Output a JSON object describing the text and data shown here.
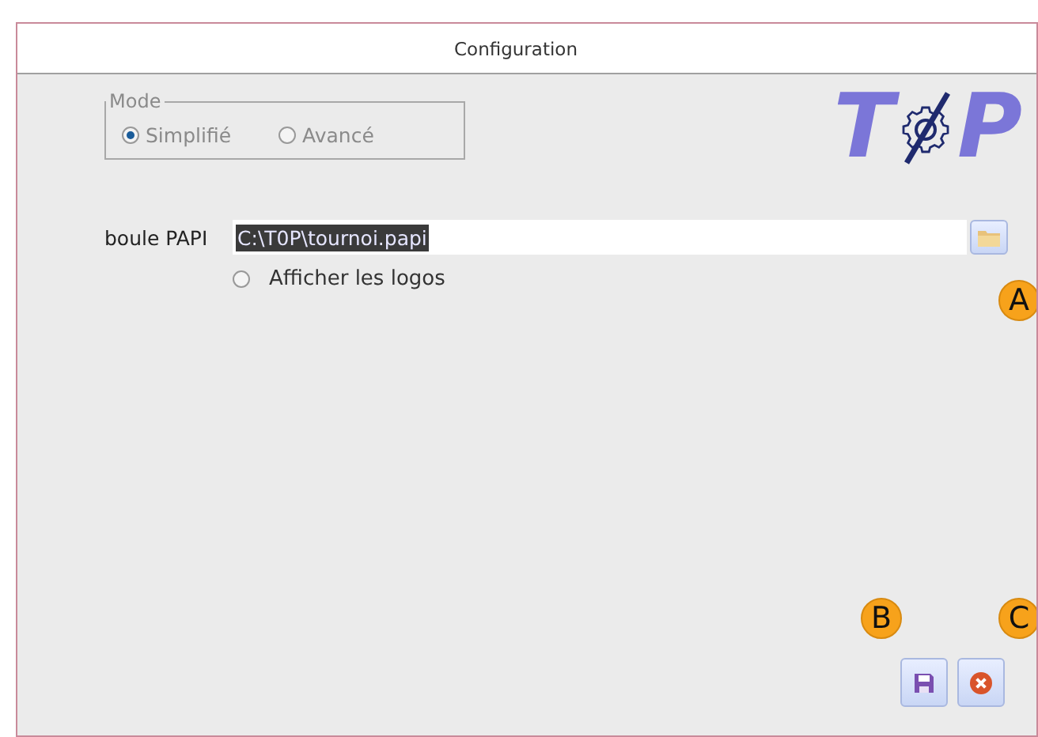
{
  "window": {
    "title": "Configuration"
  },
  "mode": {
    "legend": "Mode",
    "options": [
      {
        "label": "Simplifié",
        "selected": true,
        "disabled": true
      },
      {
        "label": "Avancé",
        "selected": false,
        "disabled": true
      }
    ]
  },
  "logo": {
    "letters": [
      "T",
      "P"
    ]
  },
  "papi_file": {
    "label": "boule PAPI",
    "value": "C:\\T0P\\tournoi.papi",
    "value_selected": true,
    "browse_callout": "A"
  },
  "show_logos": {
    "label": "Afficher les logos",
    "checked": false
  },
  "buttons": [
    {
      "kind": "save",
      "callout": "B"
    },
    {
      "kind": "cancel",
      "callout": "C"
    }
  ]
}
